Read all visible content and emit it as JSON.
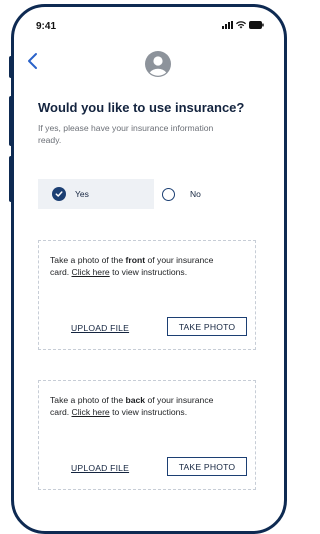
{
  "status": {
    "time": "9:41"
  },
  "header": {
    "back_icon": "chevron-left-icon",
    "avatar_icon": "user-avatar-icon"
  },
  "question": {
    "title": "Would you like to use insurance?",
    "subtitle": "If yes, please have your insurance information ready."
  },
  "options": [
    {
      "label": "Yes",
      "selected": true
    },
    {
      "label": "No",
      "selected": false
    }
  ],
  "front_card": {
    "text_before": "Take a photo of the ",
    "bold": "front",
    "text_mid": " of your insurance card. ",
    "link": "Click here",
    "text_after": " to view instructions.",
    "upload_label": "UPLOAD FILE",
    "photo_label": "TAKE PHOTO"
  },
  "back_card": {
    "text_before": "Take a photo of the ",
    "bold": "back",
    "text_mid": " of your insurance card. ",
    "link": "Click here",
    "text_after": " to view instructions.",
    "upload_label": "UPLOAD FILE",
    "photo_label": "TAKE PHOTO"
  },
  "colors": {
    "frame": "#0e2a52",
    "accent": "#1c3f73",
    "text": "#14243f",
    "muted": "#6b6f76",
    "selected_bg": "#eef1f5"
  }
}
